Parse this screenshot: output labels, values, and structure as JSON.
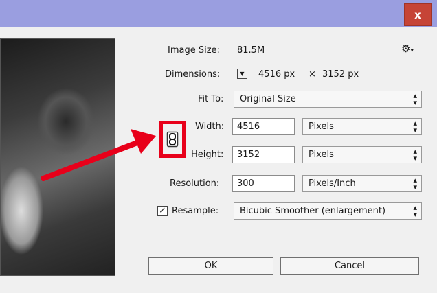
{
  "window": {
    "close_label": "x"
  },
  "image_size": {
    "label": "Image Size:",
    "value": "81.5M"
  },
  "dimensions": {
    "label": "Dimensions:",
    "width": "4516 px",
    "times": "×",
    "height": "3152 px"
  },
  "fit_to": {
    "label": "Fit To:",
    "value": "Original Size"
  },
  "width": {
    "label": "Width:",
    "value": "4516",
    "unit": "Pixels"
  },
  "height": {
    "label": "Height:",
    "value": "3152",
    "unit": "Pixels"
  },
  "resolution": {
    "label": "Resolution:",
    "value": "300",
    "unit": "Pixels/Inch"
  },
  "resample": {
    "checked": true,
    "check_mark": "✓",
    "label": "Resample:",
    "value": "Bicubic Smoother (enlargement)"
  },
  "buttons": {
    "ok": "OK",
    "cancel": "Cancel"
  },
  "icons": {
    "gear": "gear-icon",
    "chain": "chain-link-icon",
    "dimensions_dropdown": "chevron-down-icon",
    "annotation_arrow": "arrow-icon"
  },
  "colors": {
    "titlebar": "#9a9ee0",
    "close": "#c64436",
    "highlight": "#e8001a"
  }
}
